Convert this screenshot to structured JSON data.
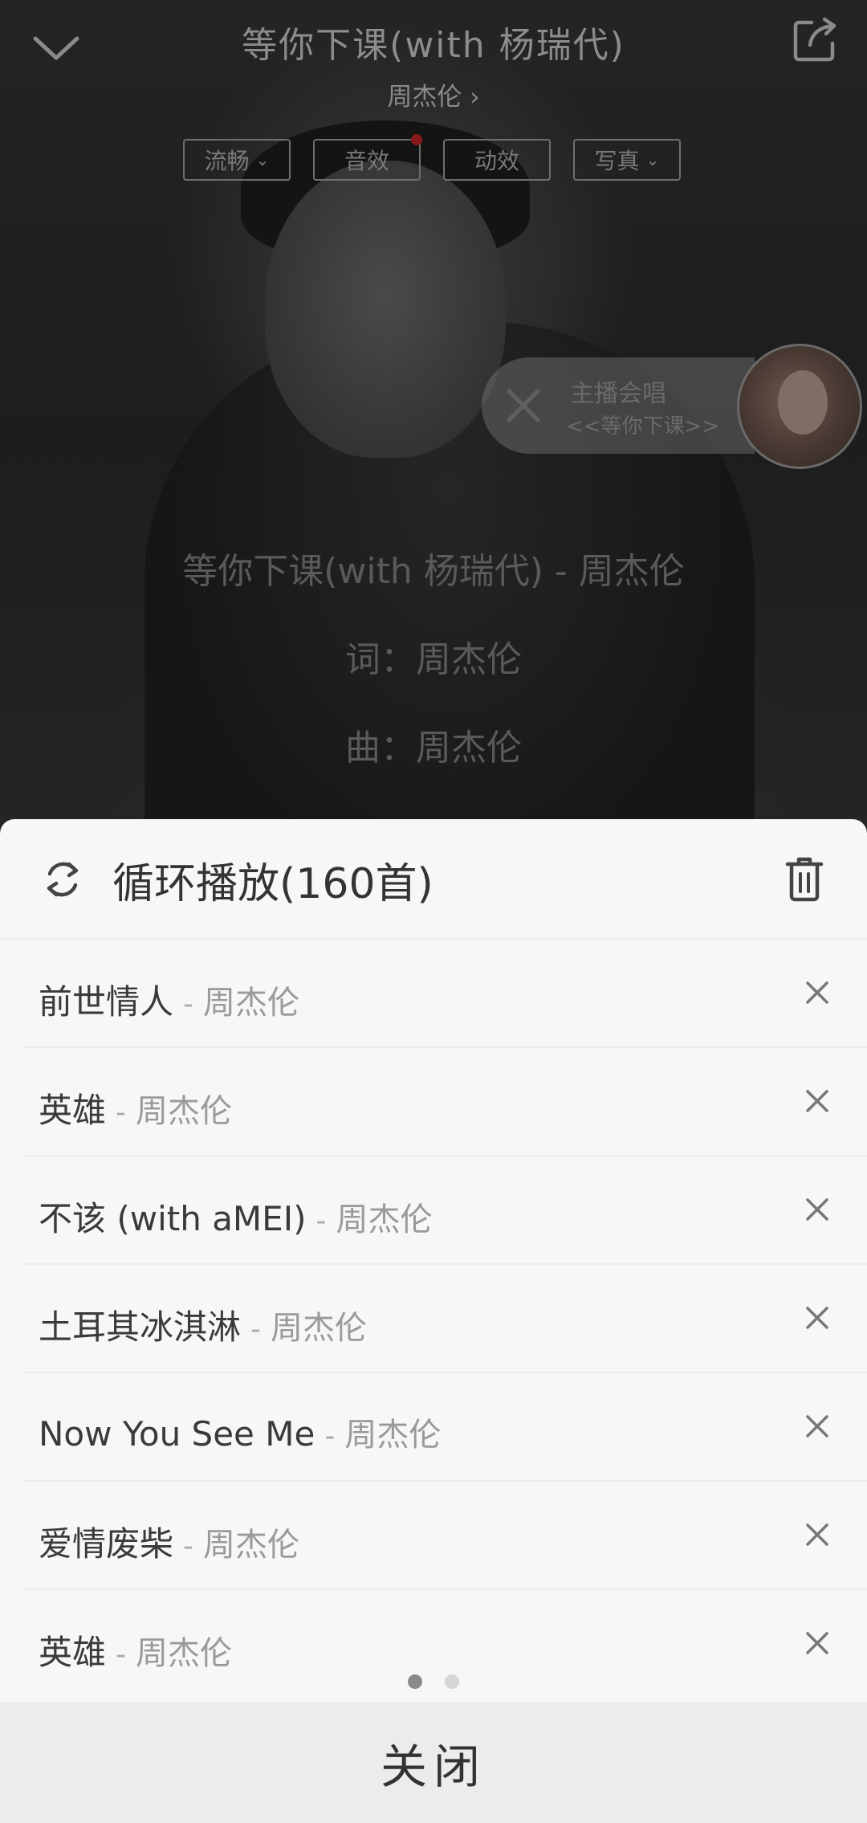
{
  "player": {
    "title": "等你下课(with 杨瑞代)",
    "artist": "周杰伦",
    "artist_arrow": "›",
    "chips": [
      {
        "label": "流畅",
        "chevron": "⌄"
      },
      {
        "label": "音效",
        "chevron": ""
      },
      {
        "label": "动效",
        "chevron": ""
      },
      {
        "label": "写真",
        "chevron": "⌄"
      }
    ],
    "karaoke": {
      "line1": "主播会唱",
      "line2": "<<等你下课>>"
    },
    "lyrics": [
      "等你下课(with 杨瑞代) - 周杰伦",
      "词：周杰伦",
      "曲：周杰伦"
    ]
  },
  "playlist": {
    "mode_label": "循环播放(160首)",
    "separator": "-",
    "songs": [
      {
        "title": "前世情人",
        "artist": "周杰伦"
      },
      {
        "title": "英雄",
        "artist": "周杰伦"
      },
      {
        "title": "不该 (with aMEI)",
        "artist": "周杰伦"
      },
      {
        "title": "土耳其冰淇淋",
        "artist": "周杰伦"
      },
      {
        "title": "Now You See Me",
        "artist": "周杰伦"
      },
      {
        "title": "爱情废柴",
        "artist": "周杰伦"
      },
      {
        "title": "英雄",
        "artist": "周杰伦"
      }
    ],
    "page_count": 2,
    "current_page": 1,
    "close_label": "关闭"
  },
  "colors": {
    "sheet_bg": "#f7f7f7",
    "close_bar_bg": "#ececec",
    "accent_dot": "#8a1a1a"
  }
}
